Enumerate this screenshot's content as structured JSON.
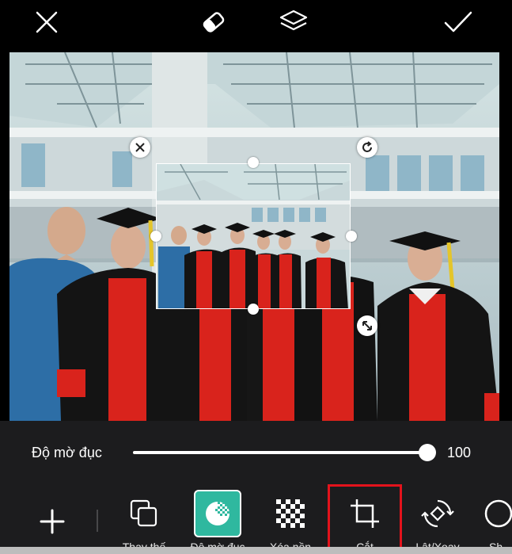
{
  "toolbar": {
    "close_icon": "close-icon",
    "eraser_icon": "eraser-icon",
    "layers_icon": "layers-icon",
    "apply_icon": "checkmark-icon"
  },
  "opacity": {
    "label": "Độ mờ đục",
    "value": "100",
    "level": 1.0
  },
  "tools": [
    {
      "label": "Thay thế",
      "icon": "replace-icon"
    },
    {
      "label": "Độ mờ đục",
      "icon": "opacity-icon",
      "active": true
    },
    {
      "label": "Xóa nền",
      "icon": "remove-background-icon"
    },
    {
      "label": "Cắt",
      "icon": "crop-icon",
      "highlighted": true
    },
    {
      "label": "Lật/Xoay",
      "icon": "flip-rotate-icon"
    },
    {
      "label": "Sh",
      "icon": "shape-icon"
    }
  ],
  "colors": {
    "accent": "#2fb89f",
    "highlight": "#e3131c",
    "panel": "#1c1c1e"
  }
}
